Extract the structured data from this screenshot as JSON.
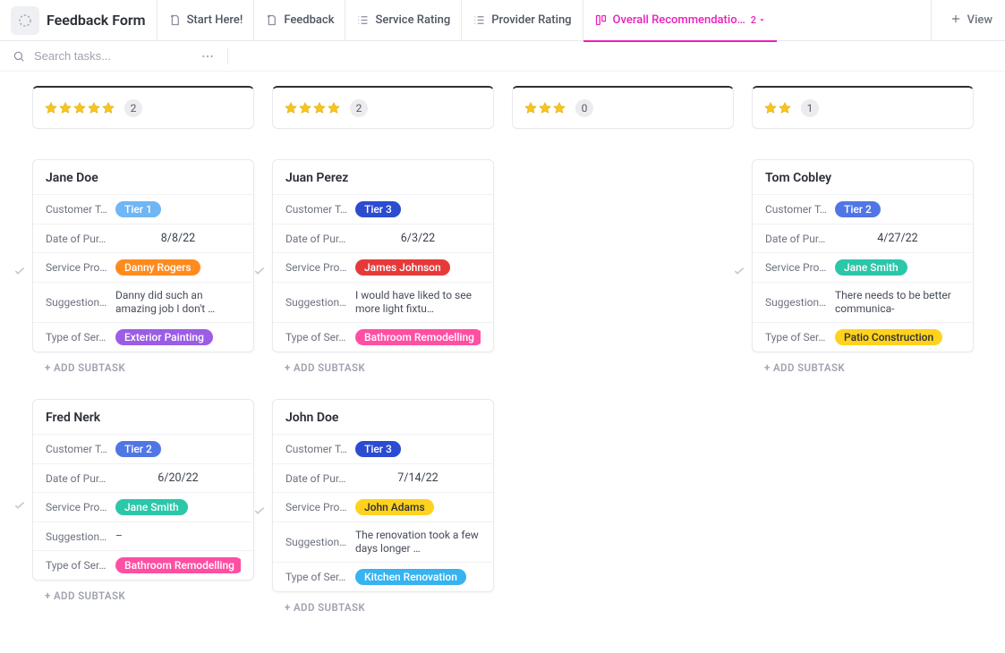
{
  "header": {
    "title": "Feedback Form",
    "tabs": [
      {
        "label": "Start Here!"
      },
      {
        "label": "Feedback"
      },
      {
        "label": "Service Rating"
      },
      {
        "label": "Provider Rating"
      },
      {
        "label": "Overall Recommendation Rating",
        "active": true,
        "count": "2"
      }
    ],
    "view_label": "View"
  },
  "search": {
    "placeholder": "Search tasks..."
  },
  "field_labels": {
    "tier": "Customer T…",
    "date": "Date of Pur…",
    "provider": "Service Pro…",
    "suggestions": "Suggestion…",
    "service": "Type of Ser…"
  },
  "add_subtask_label": "+ ADD SUBTASK",
  "columns": [
    {
      "stars": 5,
      "count": "2",
      "cards": [
        {
          "name": "Jane Doe",
          "tier": {
            "text": "Tier 1",
            "cls": "tier1"
          },
          "date": "8/8/22",
          "provider": {
            "text": "Danny Rogers",
            "cls": "sp-orange"
          },
          "suggestions": "Danny did such an amazing job I don't …",
          "service": {
            "text": "Exterior Painting",
            "cls": "svc-purple"
          }
        },
        {
          "name": "Fred Nerk",
          "tier": {
            "text": "Tier 2",
            "cls": "tier2"
          },
          "date": "6/20/22",
          "provider": {
            "text": "Jane Smith",
            "cls": "sp-teal"
          },
          "suggestions": "–",
          "service": {
            "text": "Bathroom Remodelling",
            "cls": "svc-pink"
          }
        }
      ]
    },
    {
      "stars": 4,
      "count": "2",
      "cards": [
        {
          "name": "Juan Perez",
          "tier": {
            "text": "Tier 3",
            "cls": "tier3"
          },
          "date": "6/3/22",
          "provider": {
            "text": "James Johnson",
            "cls": "sp-red"
          },
          "suggestions": "I would have liked to see more light fixtu…",
          "service": {
            "text": "Bathroom Remodelling",
            "cls": "svc-pink"
          }
        },
        {
          "name": "John Doe",
          "tier": {
            "text": "Tier 3",
            "cls": "tier3"
          },
          "date": "7/14/22",
          "provider": {
            "text": "John Adams",
            "cls": "sp-yellow"
          },
          "suggestions": "The renovation took a few days longer …",
          "service": {
            "text": "Kitchen Renovation",
            "cls": "svc-blue"
          }
        }
      ]
    },
    {
      "stars": 3,
      "count": "0",
      "cards": []
    },
    {
      "stars": 2,
      "count": "1",
      "cards": [
        {
          "name": "Tom Cobley",
          "tier": {
            "text": "Tier 2",
            "cls": "tier2"
          },
          "date": "4/27/22",
          "provider": {
            "text": "Jane Smith",
            "cls": "sp-teal"
          },
          "suggestions": "There needs to be better communica-",
          "service": {
            "text": "Patio Construction",
            "cls": "svc-yellow"
          }
        }
      ]
    }
  ]
}
